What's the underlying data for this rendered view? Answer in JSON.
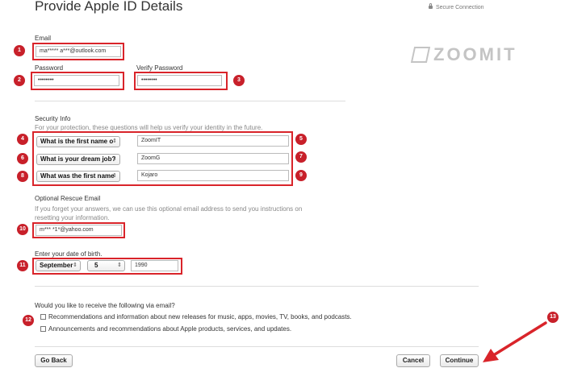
{
  "header": {
    "title": "Provide Apple ID Details",
    "secure_label": "Secure Connection"
  },
  "watermark": {
    "text": "ZOOMIT"
  },
  "account": {
    "email_label": "Email",
    "email_value": "ma***** a***@outlook.com",
    "password_label": "Password",
    "password_value": "••••••••",
    "verify_label": "Verify Password",
    "verify_value": "••••••••"
  },
  "security": {
    "heading": "Security Info",
    "help": "For your protection, these questions will help us verify your identity in the future.",
    "questions": [
      {
        "question": "What is the first name o",
        "answer": "ZoomIT"
      },
      {
        "question": "What is your dream job?",
        "answer": "ZoomG"
      },
      {
        "question": "What was the first name",
        "answer": "Kojaro"
      }
    ]
  },
  "rescue": {
    "heading": "Optional Rescue Email",
    "help": "If you forget your answers, we can use this optional email address to send you instructions on resetting your information.",
    "email_value": "m*** *1*@yahoo.com"
  },
  "birth": {
    "label": "Enter your date of birth.",
    "month": "September",
    "day": "5",
    "year": "1990"
  },
  "newsletter": {
    "heading": "Would you like to receive the following via email?",
    "option1": "Recommendations and information about new releases for music, apps, movies, TV, books, and podcasts.",
    "option2": "Announcements and recommendations about Apple products, services, and updates."
  },
  "buttons": {
    "back": "Go Back",
    "cancel": "Cancel",
    "continue": "Continue"
  },
  "annotations": [
    "1",
    "2",
    "3",
    "4",
    "5",
    "6",
    "7",
    "8",
    "9",
    "10",
    "11",
    "12",
    "13"
  ],
  "colors": {
    "annotation_red": "#d9242a",
    "badge_red": "#c8202a"
  },
  "icons": {
    "secure": "lock-icon",
    "select": "chevron-updown-icon"
  }
}
